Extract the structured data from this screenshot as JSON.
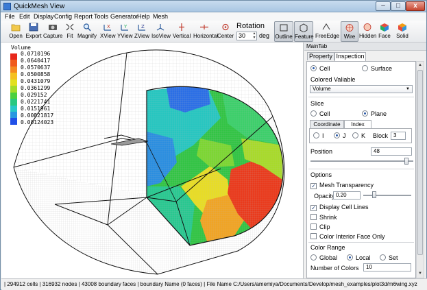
{
  "window": {
    "title": "QuickMesh View",
    "min_label": "–",
    "max_label": "□",
    "close_label": "x"
  },
  "menu": [
    "File",
    "Edit",
    "Display",
    "Config",
    "Report",
    "Tools",
    "Generator",
    "Help",
    "Mesh"
  ],
  "toolbar": {
    "buttons": [
      {
        "label": "Open",
        "icon": "folder-icon"
      },
      {
        "label": "Export",
        "icon": "save-icon"
      },
      {
        "label": "Capture",
        "icon": "camera-icon"
      },
      {
        "label": "Fit",
        "icon": "fit-icon"
      },
      {
        "label": "Magnify",
        "icon": "magnify-icon"
      },
      {
        "label": "XView",
        "icon": "x-axis-view-icon"
      },
      {
        "label": "YView",
        "icon": "y-axis-view-icon"
      },
      {
        "label": "ZView",
        "icon": "z-axis-view-icon"
      },
      {
        "label": "IsoView",
        "icon": "iso-view-icon"
      },
      {
        "label": "Vertical",
        "icon": "vertical-icon"
      },
      {
        "label": "Horizontal",
        "icon": "horizontal-icon"
      },
      {
        "label": "Center",
        "icon": "center-icon"
      }
    ],
    "rotation_label": "Rotation",
    "rotation_value": "30",
    "rotation_unit": "deg",
    "spin_up": "▲",
    "spin_down": "▼",
    "display_buttons": [
      {
        "label": "Outline",
        "icon": "outline-icon",
        "pressed": true
      },
      {
        "label": "Feature",
        "icon": "feature-icon",
        "pressed": true
      },
      {
        "label": "FreeEdge",
        "icon": "free-edge-icon",
        "pressed": false
      },
      {
        "label": "Wire",
        "icon": "wire-icon",
        "pressed": true
      },
      {
        "label": "Hidden",
        "icon": "hidden-icon",
        "pressed": false
      },
      {
        "label": "Face",
        "icon": "face-icon",
        "pressed": false
      },
      {
        "label": "Solid",
        "icon": "solid-icon",
        "pressed": false
      }
    ]
  },
  "legend": {
    "title": "Volume",
    "labels": [
      "0.0710196",
      "0.0640417",
      "0.0570637",
      "0.0500858",
      "0.0431079",
      "0.0361299",
      "0.029152",
      "0.0221741",
      "0.0151961",
      "0.00821817",
      "0.00124023"
    ],
    "colors": [
      "#e8281c",
      "#f05a1c",
      "#f58a20",
      "#f5c020",
      "#e2e020",
      "#a4dc2a",
      "#4cd040",
      "#28c880",
      "#28c8c8",
      "#2898e0",
      "#2050e8"
    ]
  },
  "panel": {
    "title": "MainTab",
    "tabs": [
      "Property",
      "Inspection"
    ],
    "active_tab": "Inspection",
    "target": {
      "cell": "Cell",
      "surface": "Surface"
    },
    "colored_variable_label": "Colored Valiable",
    "colored_variable_value": "Volume",
    "slice": {
      "title": "Slice",
      "cell": "Cell",
      "plane": "Plane",
      "subtabs": [
        "Coordinate",
        "Index"
      ],
      "axis_i": "I",
      "axis_j": "J",
      "axis_k": "K",
      "block_label": "Block",
      "block_value": "3",
      "position_label": "Position",
      "position_value": "48",
      "position_level": 0.95
    },
    "options": {
      "title": "Options",
      "mesh_transparency": "Mesh Transparency",
      "opacity_label": "Opacity",
      "opacity_value": "0.20",
      "display_cell_lines": "Display Cell Lines",
      "shrink": "Shrink",
      "clip": "Clip",
      "color_interior": "Color Interior Face Only"
    },
    "color_range": {
      "title": "Color Range",
      "global": "Global",
      "local": "Local",
      "set": "Set",
      "num_colors_label": "Number of Colors",
      "num_colors_value": "10"
    }
  },
  "status": "| 294912 cells | 316932 nodes | 43008 boundary faces | boundary Name (0 faces) | File Name C:/Users/amemiya/Documents/Develop/mesh_examples/plot3d/m6wing.xyz"
}
